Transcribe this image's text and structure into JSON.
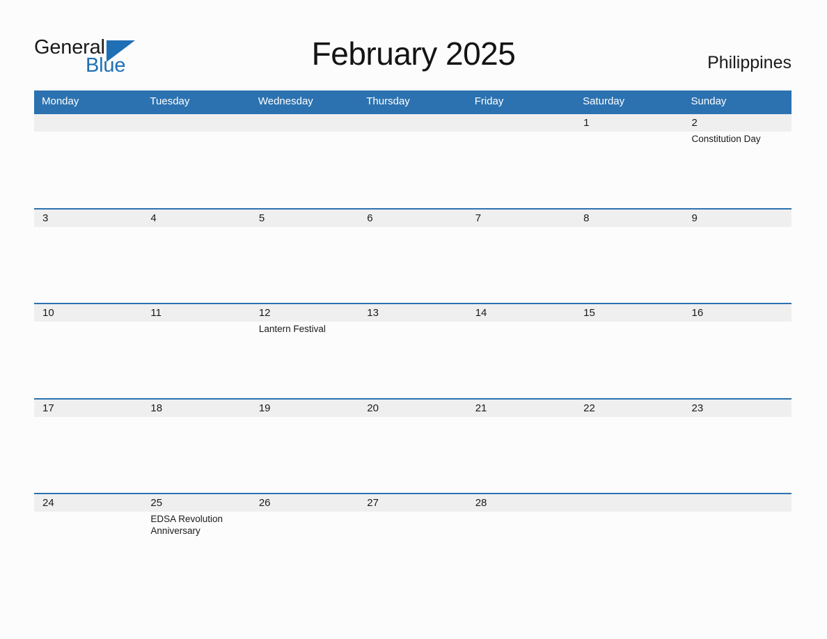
{
  "brand": {
    "name_part1": "General",
    "name_part2": "Blue",
    "triangle_color": "#1f6fb5"
  },
  "header": {
    "title": "February 2025",
    "country": "Philippines"
  },
  "colors": {
    "header_blue": "#2c72b0",
    "daynum_band": "#efefef",
    "page_background": "#fcfcfc",
    "text": "#1a1a1a"
  },
  "weekdays": [
    "Monday",
    "Tuesday",
    "Wednesday",
    "Thursday",
    "Friday",
    "Saturday",
    "Sunday"
  ],
  "weeks": [
    [
      {
        "day": "",
        "events": []
      },
      {
        "day": "",
        "events": []
      },
      {
        "day": "",
        "events": []
      },
      {
        "day": "",
        "events": []
      },
      {
        "day": "",
        "events": []
      },
      {
        "day": "1",
        "events": []
      },
      {
        "day": "2",
        "events": [
          "Constitution Day"
        ]
      }
    ],
    [
      {
        "day": "3",
        "events": []
      },
      {
        "day": "4",
        "events": []
      },
      {
        "day": "5",
        "events": []
      },
      {
        "day": "6",
        "events": []
      },
      {
        "day": "7",
        "events": []
      },
      {
        "day": "8",
        "events": []
      },
      {
        "day": "9",
        "events": []
      }
    ],
    [
      {
        "day": "10",
        "events": []
      },
      {
        "day": "11",
        "events": []
      },
      {
        "day": "12",
        "events": [
          "Lantern Festival"
        ]
      },
      {
        "day": "13",
        "events": []
      },
      {
        "day": "14",
        "events": []
      },
      {
        "day": "15",
        "events": []
      },
      {
        "day": "16",
        "events": []
      }
    ],
    [
      {
        "day": "17",
        "events": []
      },
      {
        "day": "18",
        "events": []
      },
      {
        "day": "19",
        "events": []
      },
      {
        "day": "20",
        "events": []
      },
      {
        "day": "21",
        "events": []
      },
      {
        "day": "22",
        "events": []
      },
      {
        "day": "23",
        "events": []
      }
    ],
    [
      {
        "day": "24",
        "events": []
      },
      {
        "day": "25",
        "events": [
          "EDSA Revolution Anniversary"
        ]
      },
      {
        "day": "26",
        "events": []
      },
      {
        "day": "27",
        "events": []
      },
      {
        "day": "28",
        "events": []
      },
      {
        "day": "",
        "events": []
      },
      {
        "day": "",
        "events": []
      }
    ]
  ]
}
